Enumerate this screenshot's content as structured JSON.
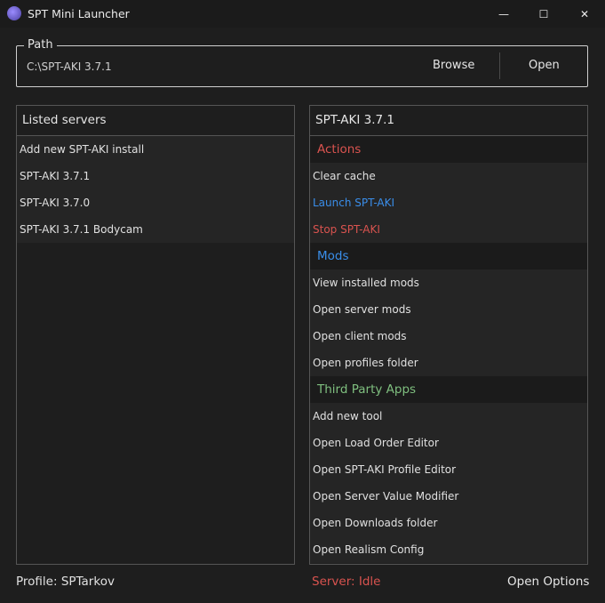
{
  "window": {
    "title": "SPT Mini Launcher",
    "controls": {
      "minimize": "—",
      "maximize": "☐",
      "close": "✕"
    }
  },
  "path": {
    "legend": "Path",
    "value": "C:\\SPT-AKI 3.7.1",
    "browse_label": "Browse",
    "open_label": "Open"
  },
  "servers": {
    "header": "Listed servers",
    "items": [
      "Add new SPT-AKI install",
      "SPT-AKI 3.7.1",
      "SPT-AKI 3.7.0",
      "SPT-AKI 3.7.1 Bodycam"
    ]
  },
  "details": {
    "header": "SPT-AKI 3.7.1",
    "actions_title": "Actions",
    "actions": [
      "Clear cache",
      "Launch SPT-AKI",
      "Stop SPT-AKI"
    ],
    "mods_title": "Mods",
    "mods": [
      "View installed mods",
      "Open server mods",
      "Open client mods",
      "Open profiles folder"
    ],
    "third_party_title": "Third Party Apps",
    "third_party": [
      "Add new tool",
      "Open Load Order Editor",
      "Open SPT-AKI Profile Editor",
      "Open Server Value Modifier",
      "Open Downloads folder",
      "Open Realism Config"
    ]
  },
  "footer": {
    "profile": "Profile: SPTarkov",
    "server_status": "Server: Idle",
    "options_label": "Open Options"
  },
  "colors": {
    "background": "#1e1e1e",
    "row": "#252525",
    "accent_blue": "#3a8eea",
    "accent_red": "#d9534f",
    "accent_green": "#7fbf7f"
  },
  "icons": {
    "app": "spt-launcher-icon"
  }
}
